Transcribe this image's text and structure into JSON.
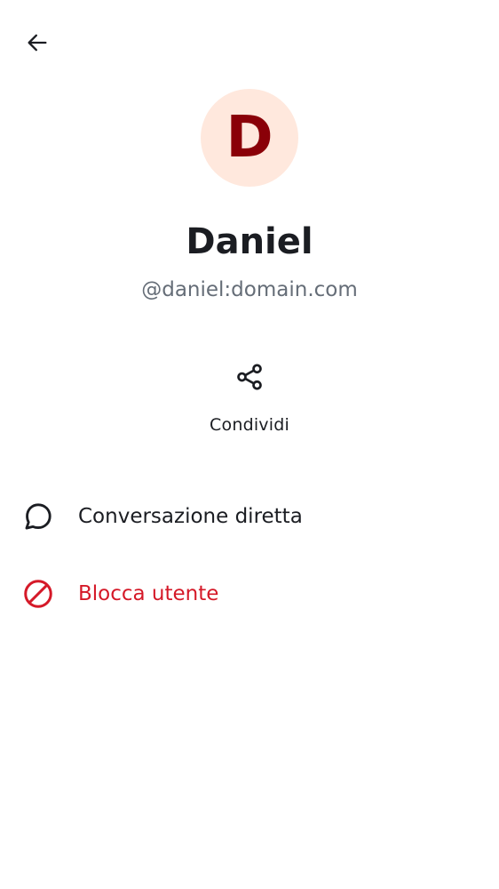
{
  "header": {
    "back_icon": "arrow-left-icon"
  },
  "profile": {
    "avatar_letter": "D",
    "avatar_bg": "#ffe8dd",
    "avatar_fg": "#8a0008",
    "display_name": "Daniel",
    "user_id": "@daniel:domain.com"
  },
  "share": {
    "icon": "share-icon",
    "label": "Condividi"
  },
  "actions": [
    {
      "icon": "chat-bubble-icon",
      "label": "Conversazione diretta",
      "color": "#1b1d22"
    },
    {
      "icon": "block-icon",
      "label": "Blocca utente",
      "color": "#d51928"
    }
  ],
  "colors": {
    "text_primary": "#1b1d22",
    "text_secondary": "#656d77",
    "critical": "#d51928"
  }
}
